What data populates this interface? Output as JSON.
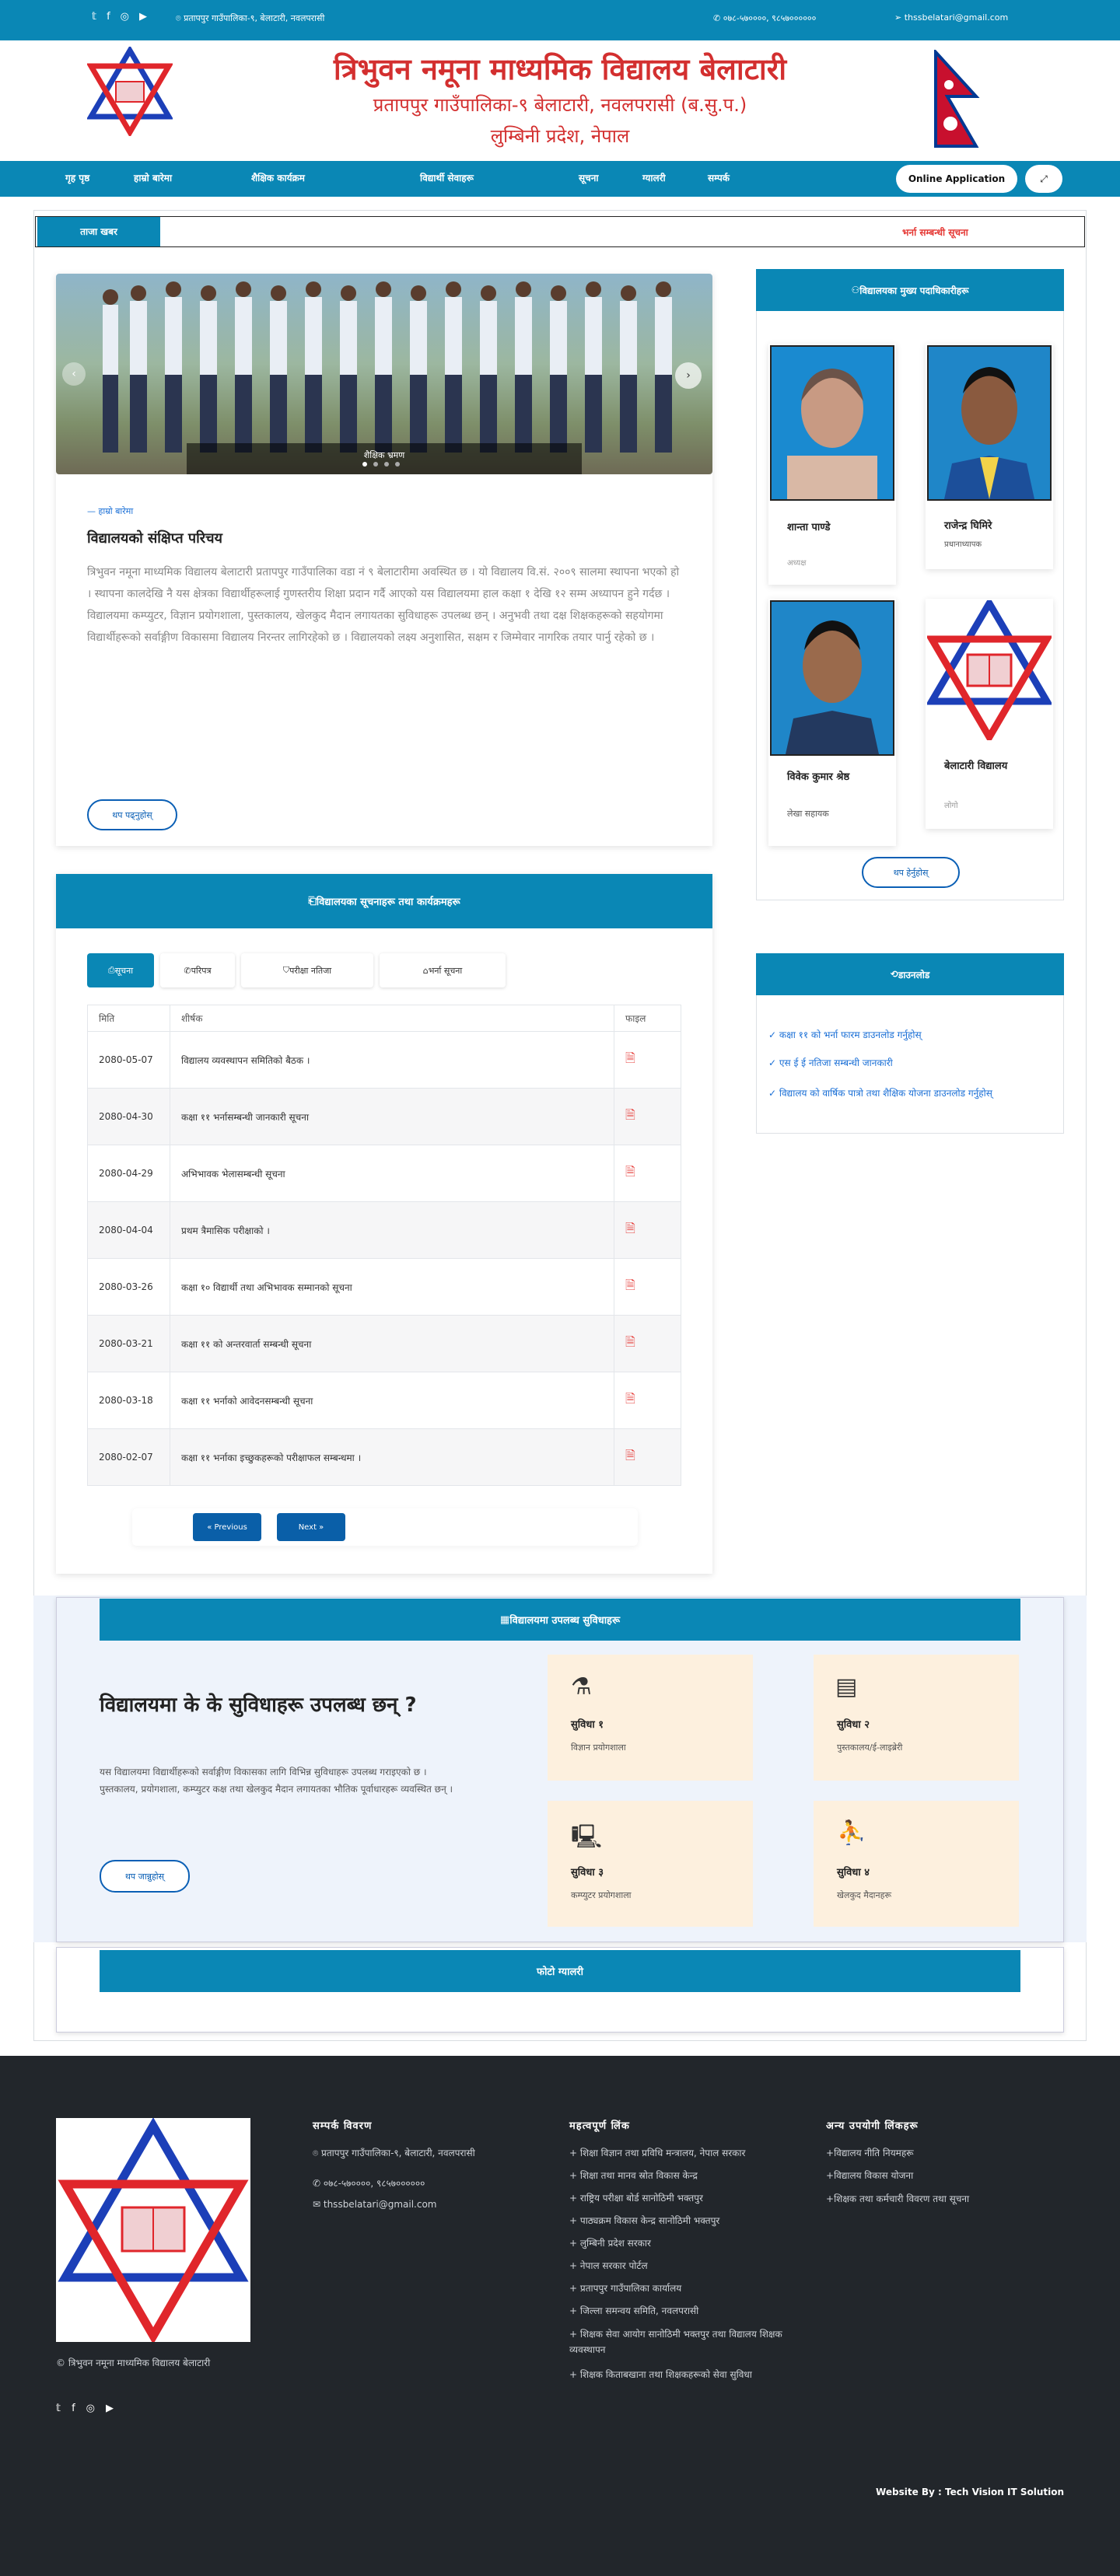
{
  "topbar": {
    "address": "प्रतापपुर गाउँपालिका-९, बेलाटारी, नवलपरासी",
    "phone": "०७८-५७००००, ९८५७०००००० ",
    "email": "thssbelatari@gmail.com"
  },
  "header": {
    "title": "त्रिभुवन नमूना माध्यमिक विद्यालय बेलाटारी",
    "line2": "प्रतापपुर गाउँपालिका-९ बेलाटारी, नवलपरासी (ब.सु.प.)",
    "line3": "लुम्बिनी प्रदेश, नेपाल"
  },
  "nav": {
    "items": [
      "गृह पृष्ठ",
      "हाम्रो बारेमा",
      "शैक्षिक कार्यक्रम",
      "विद्यार्थी सेवाहरू",
      "सूचना",
      "ग्यालरी",
      "सम्पर्क"
    ],
    "online_application": "Online Application",
    "expand_icon": "expand-icon"
  },
  "ticker": {
    "label": "ताजा खबर",
    "text": "भर्ना सम्बन्धी सूचना"
  },
  "slider": {
    "caption": "शैक्षिक भ्रमण"
  },
  "about": {
    "tag": "हाम्रो बारेमा",
    "heading": "विद्यालयको संक्षिप्त परिचय",
    "body": "त्रिभुवन नमूना माध्यमिक विद्यालय बेलाटारी प्रतापपुर गाउँपालिका वडा नं ९ बेलाटारीमा अवस्थित छ । यो विद्यालय वि.सं. २००९ सालमा स्थापना भएको हो । स्थापना कालदेखि नै यस क्षेत्रका विद्यार्थीहरूलाई गुणस्तरीय शिक्षा प्रदान गर्दै आएको यस विद्यालयमा हाल कक्षा १ देखि १२ सम्म अध्यापन हुने गर्दछ । विद्यालयमा कम्प्युटर, विज्ञान प्रयोगशाला, पुस्तकालय, खेलकुद मैदान लगायतका सुविधाहरू उपलब्ध छन् । अनुभवी तथा दक्ष शिक्षकहरूको सहयोगमा विद्यार्थीहरूको सर्वाङ्गीण विकासमा विद्यालय निरन्तर लागिरहेको छ । विद्यालयको लक्ष्य अनुशासित, सक्षम र जिम्मेवार नागरिक तयार पार्नु रहेको छ ।",
    "button": "थप पढ्नुहोस्"
  },
  "notices": {
    "heading": "विद्यालयका सूचनाहरू तथा कार्यक्रमहरू",
    "tabs": [
      "सूचना",
      "परिपत्र",
      "परीक्षा नतिजा",
      "भर्ना सूचना"
    ],
    "col_date": "मिति",
    "col_title": "शीर्षक",
    "col_file": "फाइल",
    "rows": [
      {
        "date": "2080-05-07",
        "title": "विद्यालय व्यवस्थापन समितिको बैठक ।"
      },
      {
        "date": "2080-04-30",
        "title": "कक्षा ११ भर्नासम्बन्धी जानकारी सूचना"
      },
      {
        "date": "2080-04-29",
        "title": "अभिभावक भेलासम्बन्धी सूचना"
      },
      {
        "date": "2080-04-04",
        "title": "प्रथम त्रैमासिक परीक्षाको ।"
      },
      {
        "date": "2080-03-26",
        "title": "कक्षा १० विद्यार्थी तथा अभिभावक सम्मानको सूचना"
      },
      {
        "date": "2080-03-21",
        "title": "कक्षा ११ को अन्तरवार्ता सम्बन्धी सूचना"
      },
      {
        "date": "2080-03-18",
        "title": "कक्षा ११ भर्नाको आवेदनसम्बन्धी सूचना"
      },
      {
        "date": "2080-02-07",
        "title": "कक्षा ११ भर्नाका इच्छुकहरूको परीक्षाफल सम्बन्धमा ।"
      }
    ],
    "prev": "« Previous",
    "next": "Next »"
  },
  "staff": {
    "heading": "विद्यालयका मुख्य पदाधिकारीहरू",
    "people": [
      {
        "name": "शान्ता पाण्डे",
        "role": "अध्यक्ष"
      },
      {
        "name": "राजेन्द्र घिमिरे",
        "role": "प्रधानाध्यापक"
      },
      {
        "name": "विवेक कुमार श्रेष्ठ",
        "role": "लेखा सहायक"
      },
      {
        "name": "बेलाटारी विद्यालय",
        "role": "लोगो"
      }
    ],
    "button": "थप हेर्नुहोस्"
  },
  "downloads": {
    "heading": "डाउनलोड",
    "items": [
      "कक्षा ११ को भर्ना फारम डाउनलोड गर्नुहोस्",
      "एस ई ई नतिजा सम्बन्धी जानकारी",
      "विद्यालय को वार्षिक पात्रो तथा शैक्षिक योजना डाउनलोड गर्नुहोस्"
    ]
  },
  "facilities": {
    "heading": "विद्यालयमा उपलब्ध सुविधाहरू",
    "title": "विद्यालयमा के के सुविधाहरू उपलब्ध छन् ?",
    "body": "यस विद्यालयमा विद्यार्थीहरूको सर्वाङ्गीण विकासका लागि विभिन्न सुविधाहरू उपलब्ध गराइएको छ । पुस्तकालय, प्रयोगशाला, कम्प्युटर कक्ष तथा खेलकुद मैदान लगायतका भौतिक पूर्वाधारहरू व्यवस्थित छन् ।",
    "button": "थप जान्नुहोस्",
    "boxes": [
      {
        "num": "सुविधा १",
        "label": "विज्ञान प्रयोगशाला",
        "icon": "lab-icon"
      },
      {
        "num": "सुविधा २",
        "label": "पुस्तकालय/ई-लाइब्रेरी",
        "icon": "library-icon"
      },
      {
        "num": "सुविधा ३",
        "label": "कम्प्युटर प्रयोगशाला",
        "icon": "computer-icon"
      },
      {
        "num": "सुविधा ४",
        "label": "खेलकुद मैदानहरू",
        "icon": "sports-icon"
      }
    ]
  },
  "gallery": {
    "heading": "फोटो ग्यालरी"
  },
  "footer": {
    "copyright": "© त्रिभुवन नमूना माध्यमिक विद्यालय बेलाटारी",
    "contact_heading": "सम्पर्क विवरण",
    "contact_address": "प्रतापपुर गाउँपालिका-९, बेलाटारी, नवलपरासी",
    "contact_phone": "०७८-५७००००, ९८५७००००००",
    "contact_email": "thssbelatari@gmail.com",
    "links_heading": "महत्वपूर्ण लिंक",
    "links": [
      "शिक्षा विज्ञान तथा प्रविधि मन्त्रालय, नेपाल सरकार",
      "शिक्षा तथा मानव स्रोत विकास केन्द्र",
      "राष्ट्रिय परीक्षा बोर्ड सानोठिमी भक्तपुर",
      "पाठ्यक्रम विकास केन्द्र सानोठिमी भक्तपुर",
      "लुम्बिनी प्रदेश सरकार",
      "नेपाल सरकार पोर्टल",
      "प्रतापपुर गाउँपालिका कार्यालय",
      "जिल्ला समन्वय समिति, नवलपरासी",
      "शिक्षक सेवा आयोग सानोठिमी भक्तपुर तथा विद्यालय शिक्षक व्यवस्थापन",
      "शिक्षक किताबखाना तथा शिक्षकहरूको सेवा सुविधा"
    ],
    "other_heading": "अन्य उपयोगी लिंकहरू",
    "others": [
      "विद्यालय नीति नियमहरू",
      "विद्यालय विकास योजना",
      "शिक्षक तथा कर्मचारी विवरण तथा सूचना"
    ],
    "credit": "Website By : Tech Vision IT Solution"
  },
  "colors": {
    "primary": "#0a87b5",
    "dark": "#22262b",
    "accent": "#e53935"
  }
}
